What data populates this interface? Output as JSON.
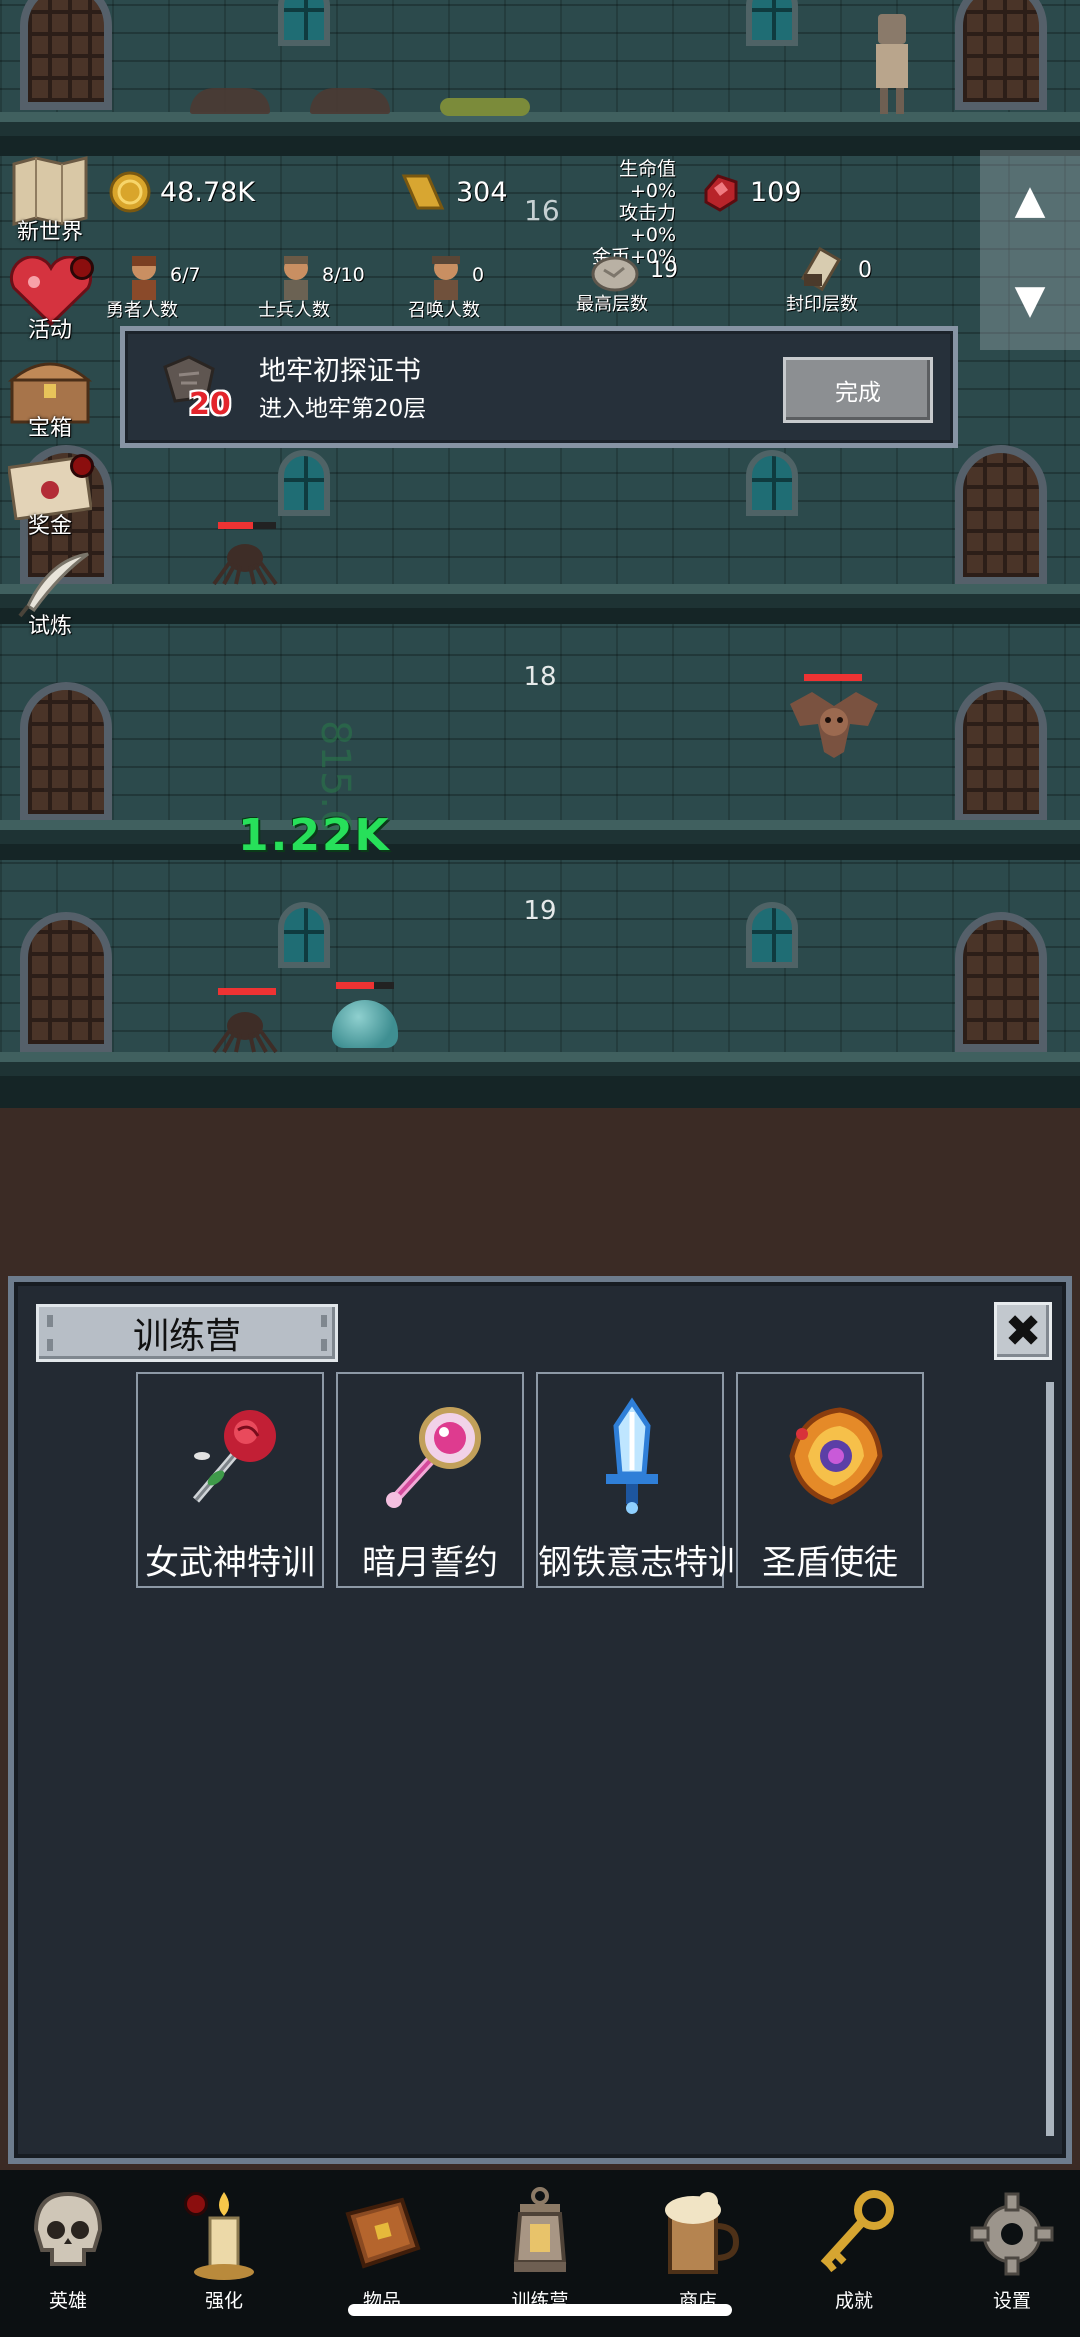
{
  "resources": {
    "gold": "48.78K",
    "gold_bars": "304",
    "gems": "109",
    "current_floor_top": "16",
    "buffs": [
      "生命值+0%",
      "攻击力+0%",
      "金币+0%"
    ]
  },
  "counters": {
    "heroes": {
      "value": "6/7",
      "label": "勇者人数"
    },
    "soldiers": {
      "value": "8/10",
      "label": "士兵人数"
    },
    "summons": {
      "value": "0",
      "label": "召唤人数"
    },
    "max_floor": {
      "value": "19",
      "label": "最高层数"
    },
    "sealed_floor": {
      "value": "0",
      "label": "封印层数"
    }
  },
  "side_menu": [
    {
      "label": "新世界",
      "dot": false
    },
    {
      "label": "活动",
      "dot": true
    },
    {
      "label": "宝箱",
      "dot": false
    },
    {
      "label": "奖金",
      "dot": true
    },
    {
      "label": "试炼",
      "dot": false
    }
  ],
  "quest": {
    "title": "地牢初探证书",
    "desc": "进入地牢第20层",
    "badge": "20",
    "button": "完成"
  },
  "floors": {
    "f18": "18",
    "f19": "19",
    "damage_big": "1.22K",
    "damage_ghost": "815.68"
  },
  "hp": {
    "f17_spider": 0.6,
    "f18_bat": 1.0,
    "f19_spider": 1.0,
    "f19_slime": 0.65
  },
  "panel": {
    "title": "训练营",
    "cards": [
      {
        "name": "女武神特训",
        "icon": "rose-wand-icon"
      },
      {
        "name": "暗月誓约",
        "icon": "moon-scepter-icon"
      },
      {
        "name": "钢铁意志特训",
        "icon": "ice-sword-icon"
      },
      {
        "name": "圣盾使徒",
        "icon": "holy-shield-icon"
      }
    ]
  },
  "nav": [
    {
      "label": "英雄",
      "icon": "skull-icon",
      "dot": false
    },
    {
      "label": "强化",
      "icon": "candle-icon",
      "dot": true
    },
    {
      "label": "物品",
      "icon": "book-icon",
      "dot": false
    },
    {
      "label": "训练营",
      "icon": "lantern-icon",
      "dot": false
    },
    {
      "label": "商店",
      "icon": "mug-icon",
      "dot": false
    },
    {
      "label": "成就",
      "icon": "key-icon",
      "dot": false
    },
    {
      "label": "设置",
      "icon": "gear-icon",
      "dot": false
    }
  ],
  "colors": {
    "panel_bg": "#232a33",
    "panel_border": "#6d7c8d",
    "damage_green": "#27e05a",
    "hp_red": "#e33333",
    "dot_red": "#8b0e0e"
  }
}
